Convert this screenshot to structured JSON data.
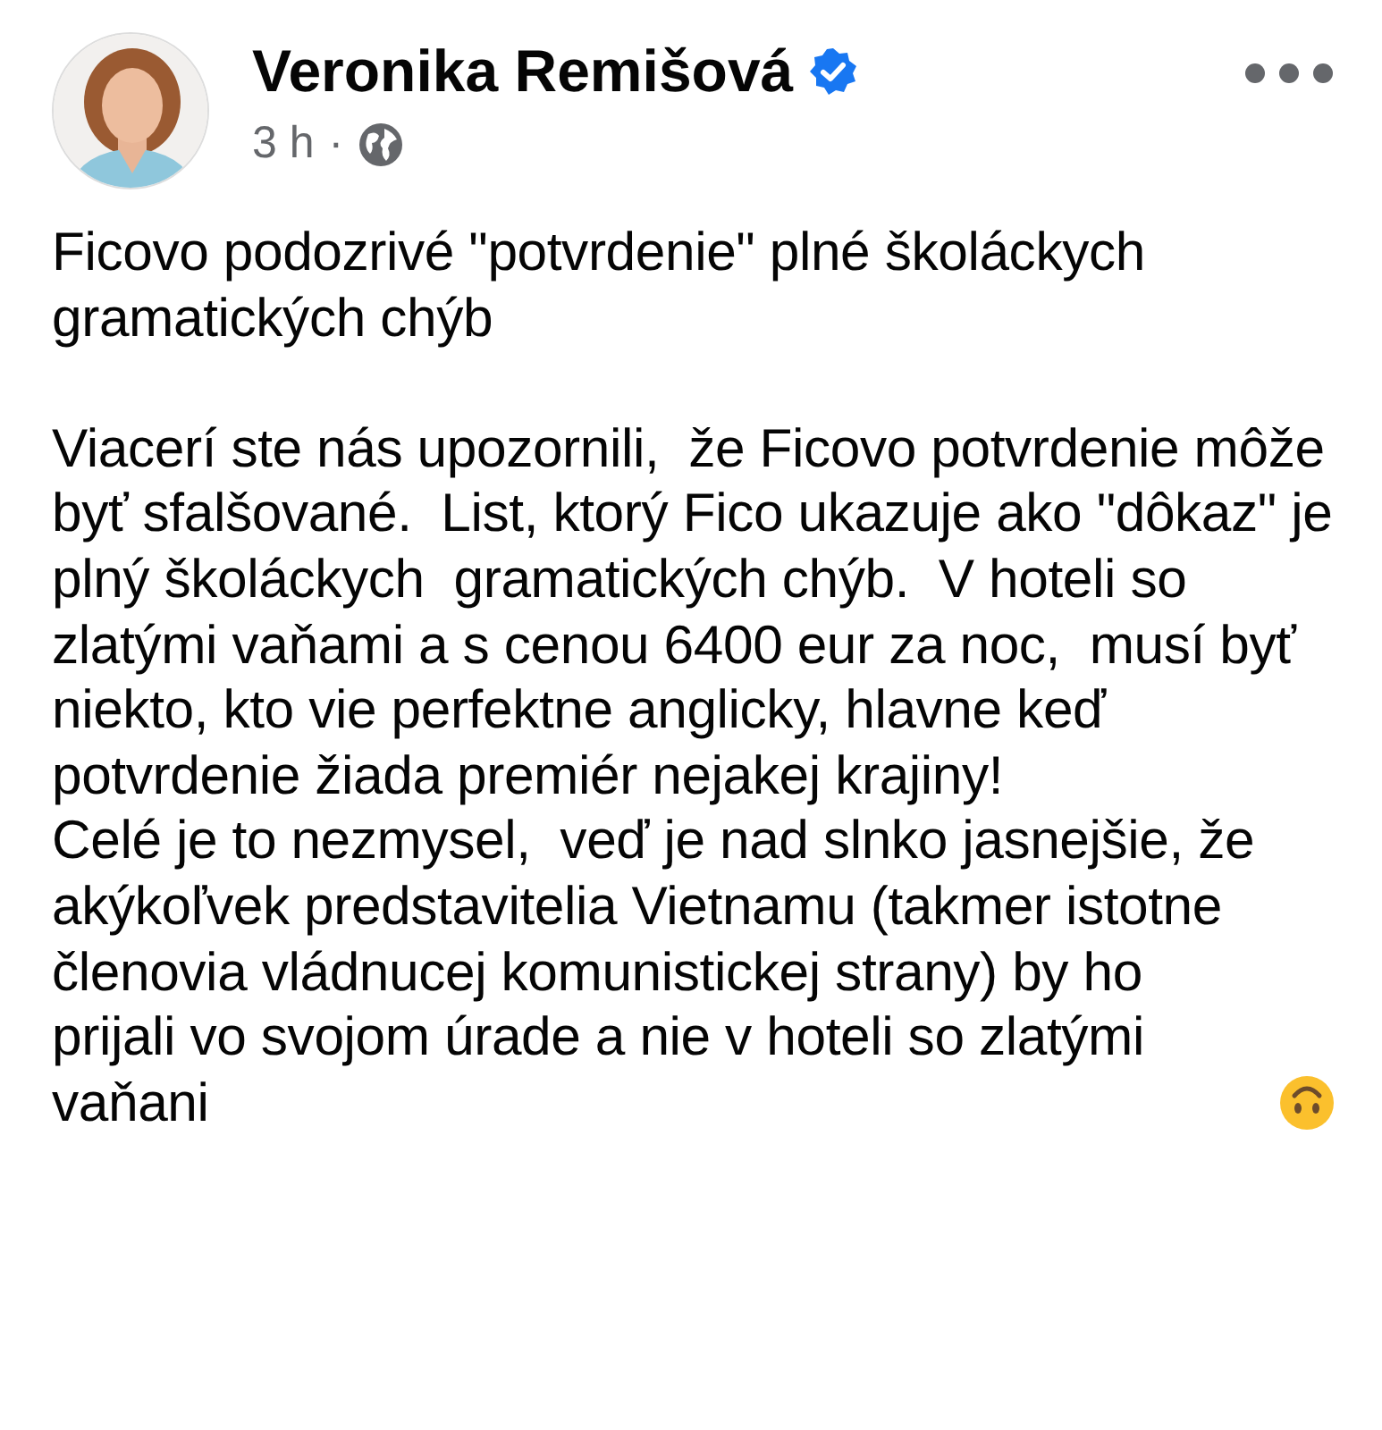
{
  "post": {
    "author": "Veronika Remišová",
    "verified": true,
    "time": "3 h",
    "separator": "·",
    "title": "Ficovo podozrivé \"potvrdenie\" plné školáckych gramatických chýb",
    "paragraphs": [
      "Viacerí ste nás upozornili,  že Ficovo potvrdenie môže byť sfalšované.  List, ktorý Fico ukazuje ako \"dôkaz\" je plný školáckych  gramatických chýb.  V hoteli so zlatými vaňami a s cenou 6400 eur za noc,  musí byť niekto, kto vie perfektne anglicky, hlavne keď potvrdenie žiada premiér nejakej krajiny!",
      "Celé je to nezmysel,  veď je nad slnko jasnejšie, že akýkoľvek predstavitelia Vietnamu (takmer istotne členovia vládnucej komunistickej strany) by ho prijali vo svojom úrade a nie v hoteli so zlatými vaňani"
    ]
  }
}
